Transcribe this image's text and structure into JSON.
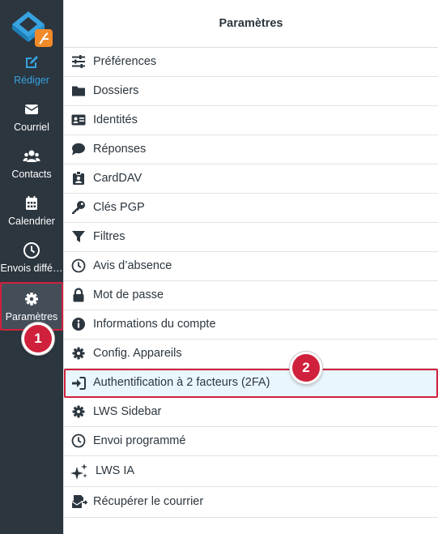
{
  "sidebar": {
    "items": [
      {
        "label": "Rédiger",
        "icon": "compose-icon"
      },
      {
        "label": "Courriel",
        "icon": "envelope-icon"
      },
      {
        "label": "Contacts",
        "icon": "users-icon"
      },
      {
        "label": "Calendrier",
        "icon": "calendar-icon"
      },
      {
        "label": "Envois diffé…",
        "icon": "clock-icon"
      },
      {
        "label": "Paramètres",
        "icon": "gear-icon"
      }
    ]
  },
  "annotations": {
    "step1": "1",
    "step2": "2"
  },
  "header": {
    "title": "Paramètres"
  },
  "settings": {
    "items": [
      {
        "label": "Préférences",
        "icon": "sliders-icon"
      },
      {
        "label": "Dossiers",
        "icon": "folder-icon"
      },
      {
        "label": "Identités",
        "icon": "id-card-icon"
      },
      {
        "label": "Réponses",
        "icon": "comment-icon"
      },
      {
        "label": "CardDAV",
        "icon": "contact-badge-icon"
      },
      {
        "label": "Clés PGP",
        "icon": "key-icon"
      },
      {
        "label": "Filtres",
        "icon": "filter-icon"
      },
      {
        "label": "Avis d’absence",
        "icon": "clock-icon"
      },
      {
        "label": "Mot de passe",
        "icon": "lock-icon"
      },
      {
        "label": "Informations du compte",
        "icon": "info-icon"
      },
      {
        "label": "Config. Appareils",
        "icon": "gear-icon"
      },
      {
        "label": "Authentification à 2 facteurs (2FA)",
        "icon": "sign-in-icon"
      },
      {
        "label": "LWS Sidebar",
        "icon": "gear-icon"
      },
      {
        "label": "Envoi programmé",
        "icon": "clock-icon"
      },
      {
        "label": "LWS IA",
        "icon": "sparkles-icon"
      },
      {
        "label": "Récupérer le courrier",
        "icon": "mail-fetch-icon"
      }
    ]
  },
  "colors": {
    "sidebar_bg": "#2c363f",
    "accent": "#37a3e0",
    "annotation_red": "#d0213c"
  }
}
